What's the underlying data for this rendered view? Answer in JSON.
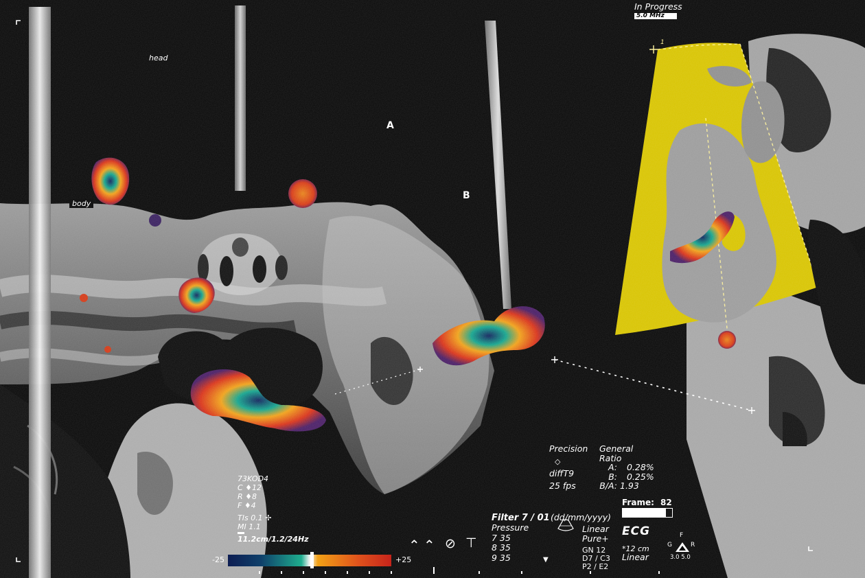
{
  "header": {
    "status": "In Progress",
    "frequency": "5.0 MHz"
  },
  "labels": {
    "head": "head",
    "body": "body",
    "a": "A",
    "b": "B",
    "marker": "1"
  },
  "params": {
    "code": "73KOD4",
    "c": "C  ♦12",
    "r": "R  ♦8",
    "f": "F  ♦4",
    "tis": "TIs 0.1",
    "mi": "MI 1.1",
    "scan": "11.2cm/1.2/24Hz"
  },
  "colorbar": {
    "min": "-25",
    "max": "+25"
  },
  "metrics": {
    "precision_label": "Precision",
    "precision_value": "diffT9",
    "fps": "25 fps",
    "general_label": "General",
    "ratio_label": "Ratio",
    "rows": [
      {
        "k": "A:",
        "v": "0.28%"
      },
      {
        "k": "B:",
        "v": "0.25%"
      },
      {
        "k": "B/A:",
        "v": "1.93"
      }
    ]
  },
  "frame": {
    "label": "Frame:",
    "value": "82",
    "level": 0.88
  },
  "filter": {
    "title": "Filter 7 / 01",
    "sub": "Pressure",
    "lines": [
      "7 35",
      "8 35",
      "9 35"
    ]
  },
  "date": {
    "format": "(dd/mm/yyyy)",
    "line1": "Linear",
    "line2": "Pure+",
    "lines": [
      "GN 12",
      "D7 / C3",
      "P2 / E2"
    ]
  },
  "ecg": {
    "title": "ECG",
    "depth": "*12 cm",
    "mode": "Linear"
  },
  "probe": {
    "f": "F",
    "g": "G",
    "r": "R",
    "range": "3.0 5.0"
  },
  "colors": {
    "yellow": "#d8c400",
    "red": "#d12a10",
    "orange": "#ee8a18",
    "teal": "#15a58e",
    "navy": "#12265e"
  },
  "icons": [
    "chevron-up-icon",
    "chevron-up-icon",
    "no-entry-icon",
    "t-icon",
    "play-down-icon",
    "fan-probe-icon",
    "triangle-probe-icon"
  ]
}
